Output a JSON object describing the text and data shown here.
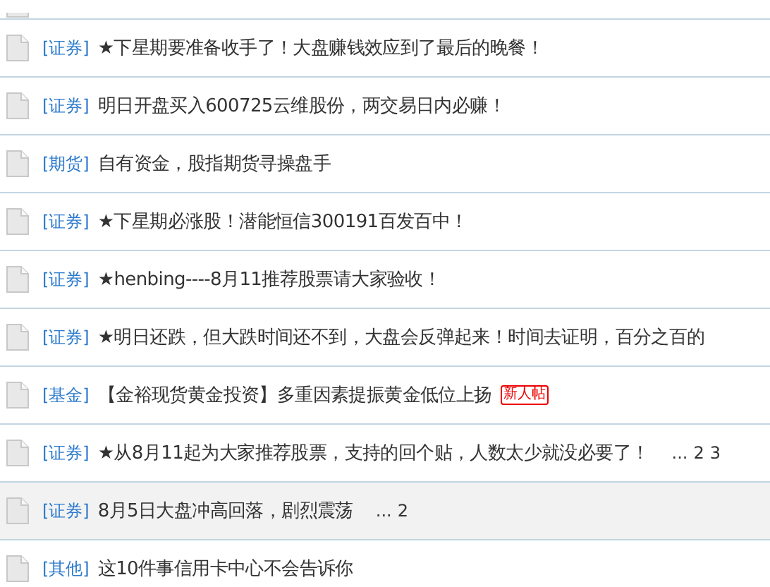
{
  "threads": [
    {
      "category": "[证券]",
      "title": "★下星期要准备收手了！大盘赚钱效应到了最后的晚餐！",
      "selected": false
    },
    {
      "category": "[证券]",
      "title": "明日开盘买入600725云维股份，两交易日内必赚！",
      "selected": false
    },
    {
      "category": "[期货]",
      "title": "自有资金，股指期货寻操盘手",
      "selected": false
    },
    {
      "category": "[证券]",
      "title": "★下星期必涨股！潜能恒信300191百发百中！",
      "selected": false
    },
    {
      "category": "[证券]",
      "title": "★henbing----8月11推荐股票请大家验收！",
      "selected": false
    },
    {
      "category": "[证券]",
      "title": "★明日还跌，但大跌时间还不到，大盘会反弹起来！时间去证明，百分之百的",
      "selected": false
    },
    {
      "category": "[基金]",
      "title": "【金裕现货黄金投资】多重因素提振黄金低位上扬",
      "badge": "新人帖",
      "selected": false
    },
    {
      "category": "[证券]",
      "title": "★从8月11起为大家推荐股票，支持的回个贴，人数太少就没必要了！",
      "ellipsis": "...",
      "pages": [
        "2",
        "3"
      ],
      "selected": false
    },
    {
      "category": "[证券]",
      "title": "8月5日大盘冲高回落，剧烈震荡",
      "ellipsis": "...",
      "pages": [
        "2"
      ],
      "selected": true
    },
    {
      "category": "[其他]",
      "title": "这10件事信用卡中心不会告诉你",
      "selected": false
    }
  ]
}
